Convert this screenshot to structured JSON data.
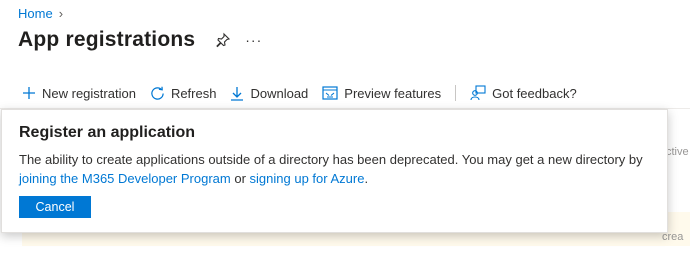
{
  "breadcrumb": {
    "home": "Home",
    "separator": "›"
  },
  "page": {
    "title": "App registrations",
    "more": "···"
  },
  "toolbar": {
    "new_registration": "New registration",
    "refresh": "Refresh",
    "download": "Download",
    "preview_features": "Preview features",
    "feedback": "Got feedback?"
  },
  "background": {
    "text1": "ctive",
    "text2": "o crea"
  },
  "dialog": {
    "title": "Register an application",
    "body_text_1": "The ability to create applications outside of a directory has been deprecated. You may get a new directory by ",
    "link_1": "joining the M365 Developer Program",
    "body_text_2": " or ",
    "link_2": "signing up for Azure",
    "body_text_3": ".",
    "cancel_label": "Cancel"
  },
  "colors": {
    "accent": "#0078d4",
    "text": "#323130",
    "warning_bg": "#fff4ce"
  }
}
